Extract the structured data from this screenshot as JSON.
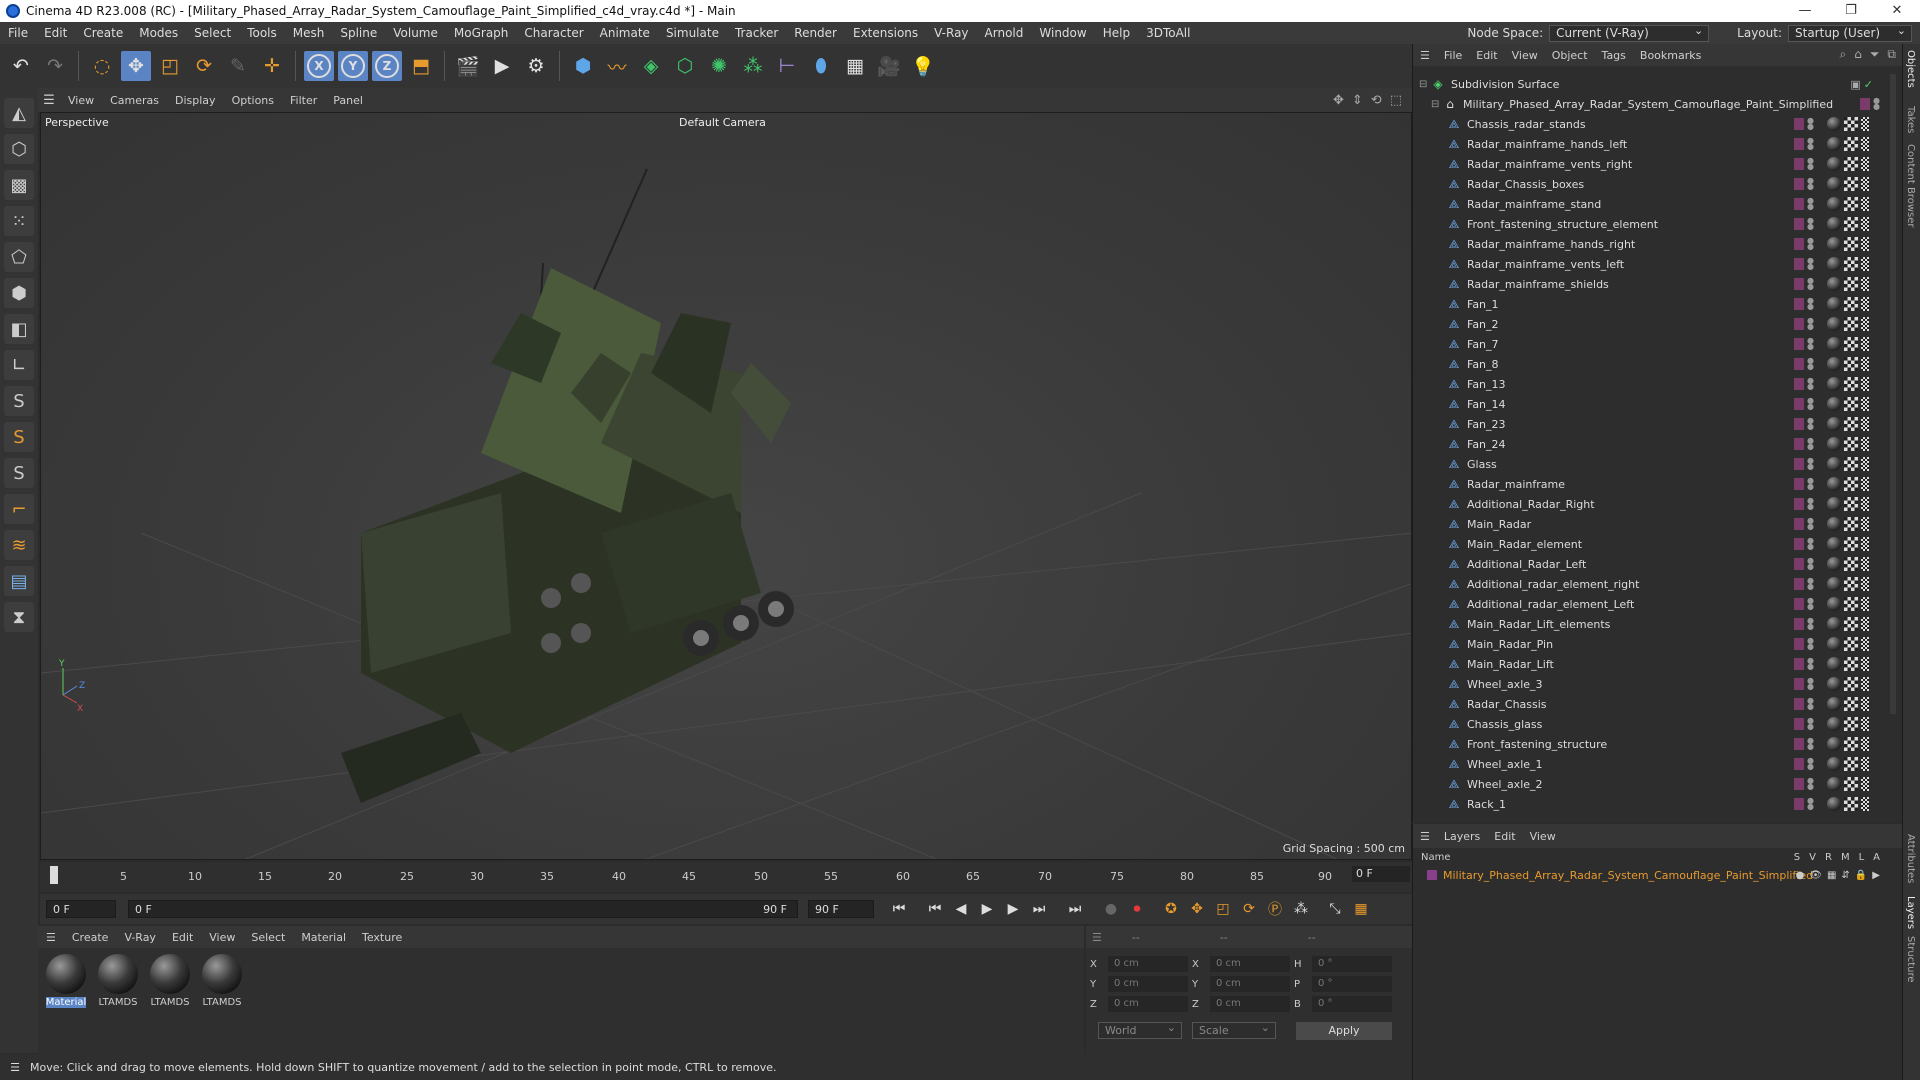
{
  "window": {
    "title": "Cinema 4D R23.008 (RC) - [Military_Phased_Array_Radar_System_Camouflage_Paint_Simplified_c4d_vray.c4d *] - Main",
    "controls": [
      "—",
      "❐",
      "✕"
    ]
  },
  "menubar": {
    "items": [
      "File",
      "Edit",
      "Create",
      "Modes",
      "Select",
      "Tools",
      "Mesh",
      "Spline",
      "Volume",
      "MoGraph",
      "Character",
      "Animate",
      "Simulate",
      "Tracker",
      "Render",
      "Extensions",
      "V-Ray",
      "Arnold",
      "Window",
      "Help",
      "3DToAll"
    ],
    "node_space_label": "Node Space:",
    "node_space_value": "Current (V-Ray)",
    "layout_label": "Layout:",
    "layout_value": "Startup (User)"
  },
  "viewport": {
    "menu": [
      "View",
      "Cameras",
      "Display",
      "Options",
      "Filter",
      "Panel"
    ],
    "label": "Perspective",
    "camera": "Default Camera",
    "grid_spacing": "Grid Spacing : 500 cm",
    "axes": {
      "y": "Y",
      "z": "Z",
      "x": "X"
    }
  },
  "timeline": {
    "ticks": [
      "0",
      "5",
      "10",
      "15",
      "20",
      "25",
      "30",
      "35",
      "40",
      "45",
      "50",
      "55",
      "60",
      "65",
      "70",
      "75",
      "80",
      "85",
      "90"
    ],
    "current_frame": "0 F"
  },
  "transport": {
    "start": "0 F",
    "range_start": "0 F",
    "range_end": "90 F",
    "end": "90 F"
  },
  "materials": {
    "menu": [
      "Create",
      "V-Ray",
      "Edit",
      "View",
      "Select",
      "Material",
      "Texture"
    ],
    "items": [
      {
        "name": "Material",
        "selected": true
      },
      {
        "name": "LTAMDS",
        "selected": false
      },
      {
        "name": "LTAMDS",
        "selected": false
      },
      {
        "name": "LTAMDS",
        "selected": false
      }
    ]
  },
  "attributes": {
    "header": [
      "--",
      "--",
      "--"
    ],
    "rows": [
      {
        "l1": "X",
        "v1": "0 cm",
        "l2": "X",
        "v2": "0 cm",
        "l3": "H",
        "v3": "0 °"
      },
      {
        "l1": "Y",
        "v1": "0 cm",
        "l2": "Y",
        "v2": "0 cm",
        "l3": "P",
        "v3": "0 °"
      },
      {
        "l1": "Z",
        "v1": "0 cm",
        "l2": "Z",
        "v2": "0 cm",
        "l3": "B",
        "v3": "0 °"
      }
    ],
    "coord_system": "World",
    "mode": "Scale",
    "apply": "Apply"
  },
  "status": {
    "text": "Move: Click and drag to move elements. Hold down SHIFT to quantize movement / add to the selection in point mode, CTRL to remove."
  },
  "objects": {
    "menu": [
      "File",
      "Edit",
      "View",
      "Object",
      "Tags",
      "Bookmarks"
    ],
    "root": "Subdivision Surface",
    "group": "Military_Phased_Array_Radar_System_Camouflage_Paint_Simplified",
    "children": [
      "Chassis_radar_stands",
      "Radar_mainframe_hands_left",
      "Radar_mainframe_vents_right",
      "Radar_Chassis_boxes",
      "Radar_mainframe_stand",
      "Front_fastening_structure_element",
      "Radar_mainframe_hands_right",
      "Radar_mainframe_vents_left",
      "Radar_mainframe_shields",
      "Fan_1",
      "Fan_2",
      "Fan_7",
      "Fan_8",
      "Fan_13",
      "Fan_14",
      "Fan_23",
      "Fan_24",
      "Glass",
      "Radar_mainframe",
      "Additional_Radar_Right",
      "Main_Radar",
      "Main_Radar_element",
      "Additional_Radar_Left",
      "Additional_radar_element_right",
      "Additional_radar_element_Left",
      "Main_Radar_Lift_elements",
      "Main_Radar_Pin",
      "Main_Radar_Lift",
      "Wheel_axle_3",
      "Radar_Chassis",
      "Chassis_glass",
      "Front_fastening_structure",
      "Wheel_axle_1",
      "Wheel_axle_2",
      "Rack_1"
    ]
  },
  "layers": {
    "menu": [
      "Layers",
      "Edit",
      "View"
    ],
    "name_header": "Name",
    "cols": [
      "S",
      "V",
      "R",
      "M",
      "L",
      "A"
    ],
    "items": [
      "Military_Phased_Array_Radar_System_Camouflage_Paint_Simplified"
    ]
  },
  "side_tabs": [
    "Objects",
    "Takes",
    "Content Browser",
    "Attributes",
    "Layers",
    "Structure"
  ]
}
